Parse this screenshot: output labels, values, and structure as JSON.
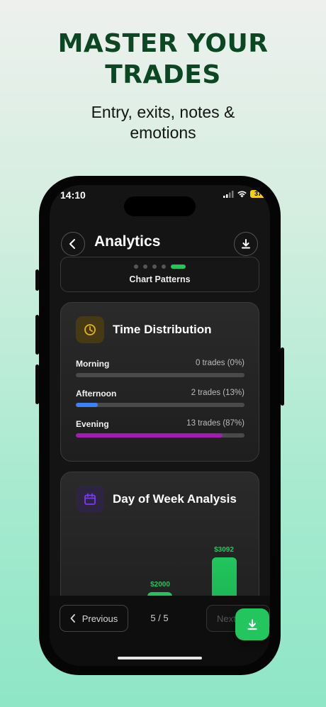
{
  "hero": {
    "headline_line1": "MASTER YOUR",
    "headline_line2": "TRADES",
    "subline_line1": "Entry, exits, notes &",
    "subline_line2": "emotions"
  },
  "status_bar": {
    "time": "14:10",
    "battery": "37"
  },
  "header": {
    "title": "Analytics",
    "back_icon": "chevron-left-icon",
    "download_icon": "download-icon"
  },
  "pattern_selector": {
    "label": "Chart Patterns",
    "total_dots": 5,
    "active_dot": 5
  },
  "time_distribution": {
    "title": "Time Distribution",
    "icon": "clock-icon",
    "accent": "#eab308",
    "rows": [
      {
        "label": "Morning",
        "value": "0 trades (0%)",
        "fraction": 0.0,
        "color": "#3b82f6"
      },
      {
        "label": "Afternoon",
        "value": "2 trades (13%)",
        "fraction": 0.13,
        "color": "#3b82f6"
      },
      {
        "label": "Evening",
        "value": "13 trades (87%)",
        "fraction": 0.87,
        "color": "#a21caf"
      }
    ]
  },
  "day_of_week": {
    "title": "Day of Week Analysis",
    "icon": "calendar-icon",
    "accent": "#7c3aed",
    "bars": [
      {
        "label": "$2000",
        "value": 2000
      },
      {
        "label": "$3092",
        "value": 3092
      }
    ]
  },
  "pager": {
    "previous_label": "Previous",
    "page_count": "5 / 5",
    "next_label": "Next"
  },
  "colors": {
    "brand_green": "#22c55e",
    "headline": "#0b4722",
    "screen_bg": "#141414"
  }
}
